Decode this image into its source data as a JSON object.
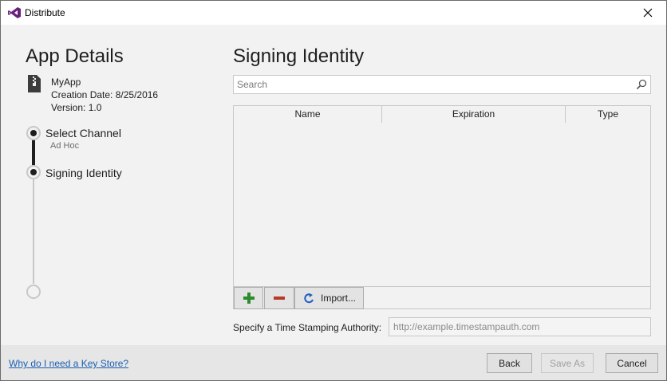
{
  "window": {
    "title": "Distribute",
    "app_icon": "visual-studio-icon",
    "close_icon": "close-icon"
  },
  "left": {
    "title": "App Details",
    "file_icon": "zip-file-icon",
    "app_name": "MyApp",
    "creation_date": "Creation Date: 8/25/2016",
    "version": "Version: 1.0",
    "steps": [
      {
        "label": "Select Channel",
        "sub": "Ad Hoc",
        "state": "done"
      },
      {
        "label": "Signing Identity",
        "sub": "",
        "state": "current"
      },
      {
        "label": "",
        "sub": "",
        "state": "pending"
      }
    ]
  },
  "main": {
    "title": "Signing Identity",
    "search": {
      "placeholder": "Search",
      "value": "",
      "icon": "search-icon"
    },
    "table": {
      "columns": [
        "Name",
        "Expiration",
        "Type"
      ],
      "rows": []
    },
    "toolbar": {
      "add_icon": "plus-icon",
      "remove_icon": "minus-icon",
      "import_icon": "import-icon",
      "import_label": "Import..."
    },
    "tsa": {
      "label": "Specify a Time Stamping Authority:",
      "placeholder": "http://example.timestampauth.com",
      "value": ""
    }
  },
  "footer": {
    "help_link": "Why do I need a Key Store?",
    "back_label": "Back",
    "save_as_label": "Save As",
    "cancel_label": "Cancel"
  },
  "colors": {
    "accent_purple": "#68217a",
    "link_blue": "#1a5fb4",
    "add_green": "#2d8a2d",
    "remove_red": "#b53a2a",
    "import_blue": "#1f5fbf"
  }
}
